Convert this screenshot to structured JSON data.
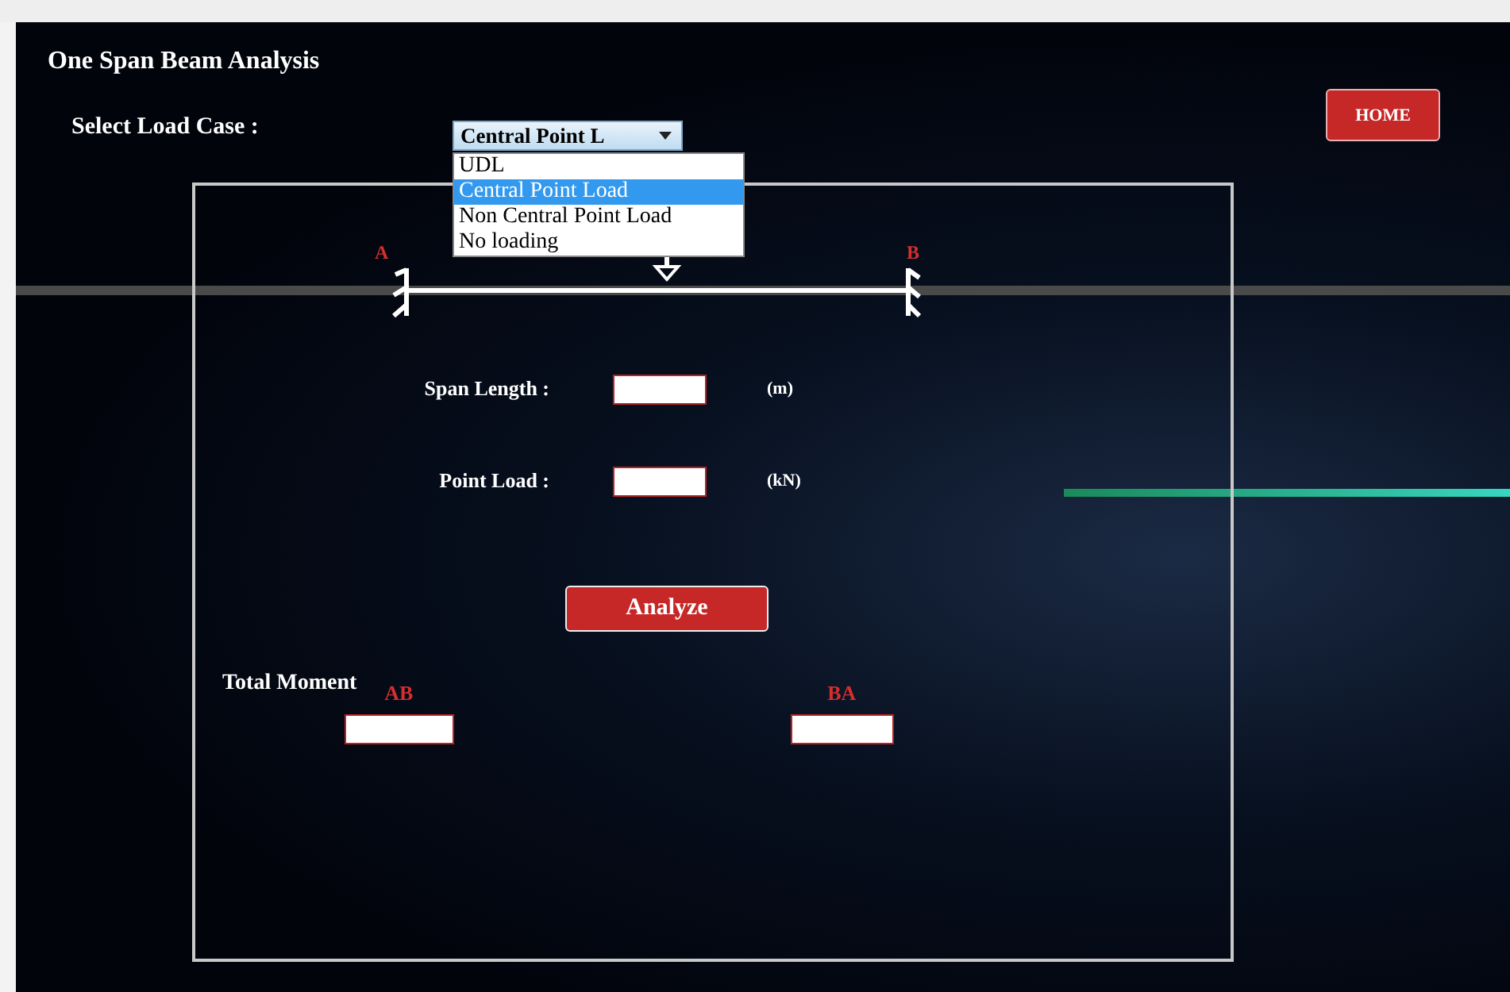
{
  "title": "One Span Beam Analysis",
  "home_button": "HOME",
  "load_case": {
    "label": "Select Load Case :",
    "value": "Central Point L",
    "expanded": true,
    "options": [
      {
        "label": "UDL",
        "selected": false
      },
      {
        "label": "Central Point Load",
        "selected": true
      },
      {
        "label": "Non Central Point Load",
        "selected": false
      },
      {
        "label": "No loading",
        "selected": false
      }
    ]
  },
  "beam": {
    "left_label": "A",
    "right_label": "B"
  },
  "fields": [
    {
      "label": "Span Length :",
      "unit": "(m)"
    },
    {
      "label": "Point Load :",
      "unit": "(kN)"
    }
  ],
  "analyze_button": "Analyze",
  "total_moment": {
    "label": "Total Moment",
    "outputs": [
      {
        "label": "AB"
      },
      {
        "label": "BA"
      }
    ]
  }
}
